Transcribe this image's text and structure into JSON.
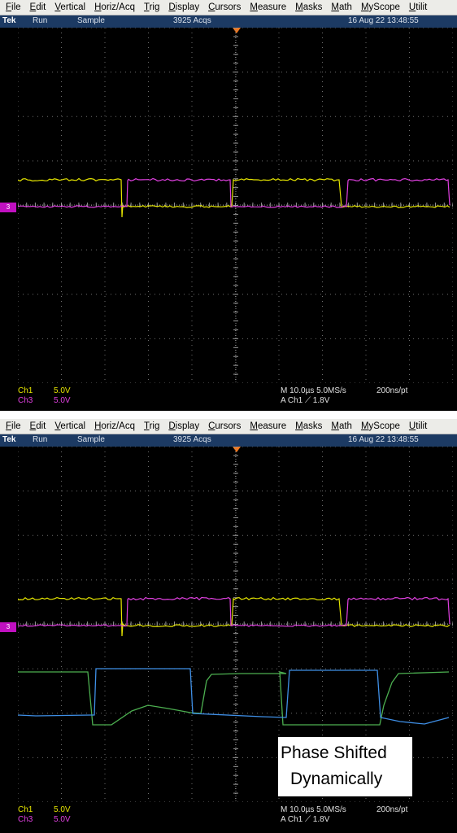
{
  "menu": [
    "File",
    "Edit",
    "Vertical",
    "Horiz/Acq",
    "Trig",
    "Display",
    "Cursors",
    "Measure",
    "Masks",
    "Math",
    "MyScope",
    "Utilit"
  ],
  "status": {
    "brand": "Tek",
    "run": "Run",
    "mode": "Sample",
    "acqs": "3925 Acqs",
    "date": "16 Aug 22 13:48:55"
  },
  "ref_marker": "3",
  "readouts": {
    "ch1_label": "Ch1",
    "ch1_scale": "5.0V",
    "ch3_label": "Ch3",
    "ch3_scale": "5.0V",
    "timebase": "M 10.0µs 5.0MS/s",
    "resolution": "200ns/pt",
    "trigger": "A  Ch1  ⟋  1.8V"
  },
  "annotation": {
    "line1": "Phase Shifted",
    "line2": "Dynamically"
  },
  "colors": {
    "ch1": "#e6e600",
    "ch3": "#e040e0",
    "green": "#4caf50",
    "blue": "#3f8fe6",
    "grid": "#6e6e6e",
    "status_bar": "#1c3a63"
  }
}
